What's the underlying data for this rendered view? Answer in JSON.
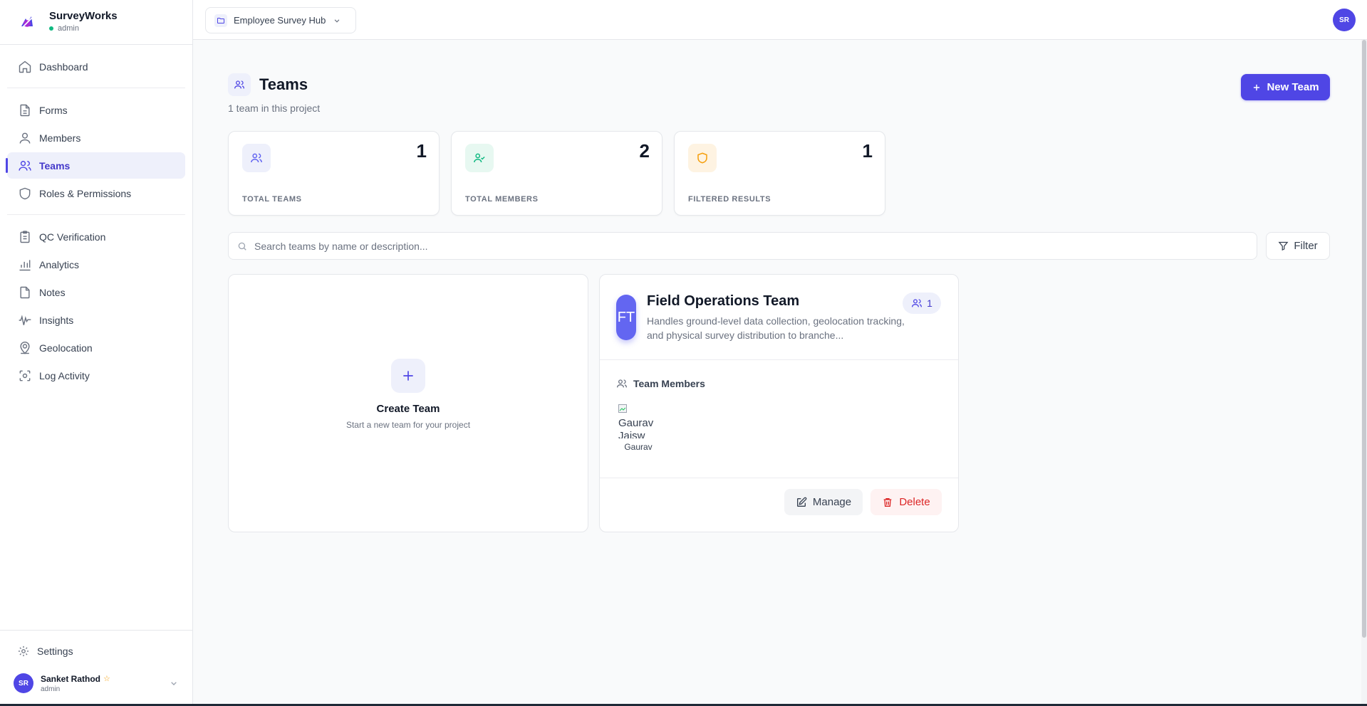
{
  "brand": {
    "name": "SurveyWorks",
    "role": "admin"
  },
  "sidebar": {
    "groups": [
      [
        {
          "label": "Dashboard",
          "icon": "home-icon"
        }
      ],
      [
        {
          "label": "Forms",
          "icon": "file-icon"
        },
        {
          "label": "Members",
          "icon": "user-icon"
        },
        {
          "label": "Teams",
          "icon": "users-icon",
          "active": true
        },
        {
          "label": "Roles & Permissions",
          "icon": "shield-icon"
        }
      ],
      [
        {
          "label": "QC Verification",
          "icon": "clipboard-icon"
        },
        {
          "label": "Analytics",
          "icon": "bar-chart-icon"
        },
        {
          "label": "Notes",
          "icon": "note-icon"
        },
        {
          "label": "Insights",
          "icon": "pulse-icon"
        },
        {
          "label": "Geolocation",
          "icon": "map-pin-icon"
        },
        {
          "label": "Log Activity",
          "icon": "scan-icon"
        }
      ]
    ],
    "settings_label": "Settings",
    "user": {
      "initials": "SR",
      "name": "Sanket Rathod",
      "role": "admin"
    }
  },
  "topbar": {
    "project": "Employee Survey Hub",
    "avatar_initials": "SR"
  },
  "page": {
    "title": "Teams",
    "subtitle": "1 team in this project",
    "new_team_label": "New Team"
  },
  "stats": [
    {
      "value": "1",
      "label": "TOTAL TEAMS",
      "icon": "users-icon",
      "color": "#6366f1",
      "bg": "#eef0fb"
    },
    {
      "value": "2",
      "label": "TOTAL MEMBERS",
      "icon": "user-check-icon",
      "color": "#10b981",
      "bg": "#e7f8f1"
    },
    {
      "value": "1",
      "label": "FILTERED RESULTS",
      "icon": "shield-icon",
      "color": "#f59e0b",
      "bg": "#fef3e2"
    }
  ],
  "search": {
    "placeholder": "Search teams by name or description...",
    "filter_label": "Filter"
  },
  "create_card": {
    "title": "Create Team",
    "subtitle": "Start a new team for your project"
  },
  "team": {
    "initials": "FT",
    "name": "Field Operations Team",
    "description": "Handles ground-level data collection, geolocation tracking, and physical survey distribution to branche...",
    "member_count": "1",
    "members_heading": "Team Members",
    "members": [
      {
        "alt": "Gaurav Jaisw",
        "name": "Gaurav"
      }
    ],
    "manage_label": "Manage",
    "delete_label": "Delete"
  },
  "colors": {
    "accent": "#4f46e5",
    "danger": "#dc2626",
    "online": "#10b981"
  }
}
